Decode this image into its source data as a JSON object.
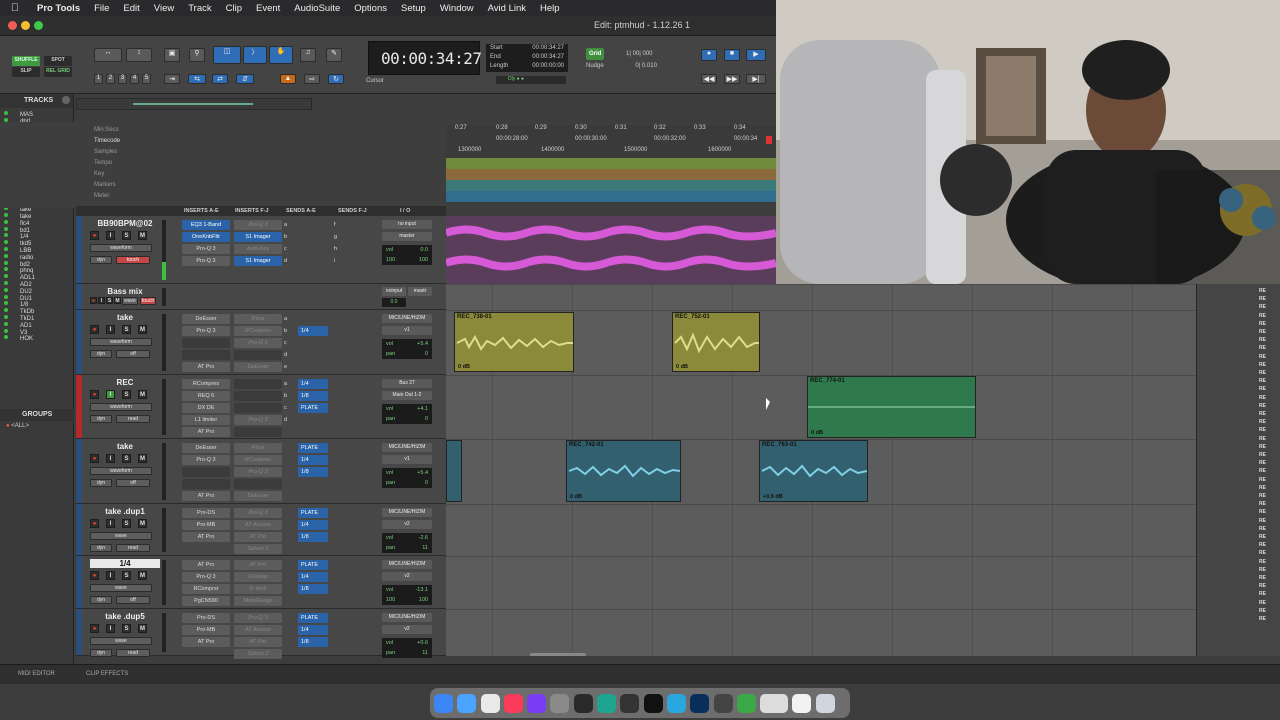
{
  "menubar": {
    "app_name": "Pro Tools",
    "items": [
      "File",
      "Edit",
      "View",
      "Track",
      "Clip",
      "Event",
      "AudioSuite",
      "Options",
      "Setup",
      "Window",
      "Avid Link",
      "Help"
    ]
  },
  "window": {
    "title": "Edit: ptmhud - 1.12.26 1"
  },
  "toolbar": {
    "modes": [
      "SHUFFLE",
      "SPOT",
      "SLIP",
      "REL GRID"
    ],
    "zoom_presets": [
      "1",
      "2",
      "3",
      "4",
      "5"
    ],
    "main_counter": "00:00:34:27",
    "cursor_label": "Cursor",
    "sub_counter": [
      {
        "label": "Start",
        "value": "00:00:34:27"
      },
      {
        "label": "End",
        "value": "00:00:34:27"
      },
      {
        "label": "Length",
        "value": "00:00:00:00"
      }
    ],
    "grid_label": "Grid",
    "grid_value": "1| 00| 000",
    "nudge_label": "Nudge",
    "nudge_value": "0| 0.010"
  },
  "rulers": {
    "rows": [
      "Min:Secs",
      "Timecode",
      "Samples",
      "Tempo",
      "Key",
      "Markers",
      "Meter"
    ],
    "minsecs_ticks": [
      "0:27",
      "0:28",
      "0:29",
      "0:30",
      "0:31",
      "0:32",
      "0:33",
      "0:34"
    ],
    "timecode_ticks": [
      "00:00:28:00",
      "00:00:30:00",
      "00:00:32:00",
      "00:00:34"
    ],
    "sample_ticks": [
      "1300000",
      "1400000",
      "1500000",
      "1600000"
    ]
  },
  "tracks_panel": {
    "title": "TRACKS",
    "items": [
      "MAS",
      "dbl1",
      "pc1",
      "pc2",
      "Verb",
      "Verb",
      "14DI",
      "18DI",
      "V2d1",
      "V2",
      "V1",
      "REC",
      "S002",
      "Bum",
      "take",
      "take",
      "flc4",
      "bd1",
      "1/4",
      "tkd5",
      "LBB",
      "radio",
      "bd2",
      "phnq",
      "ADL1",
      "AD2",
      "DU2",
      "DU1",
      "1/8",
      "TkDb",
      "TkD1",
      "AD1",
      "V3",
      "HOK"
    ],
    "groups_title": "GROUPS",
    "groups_all": "<ALL>"
  },
  "track_columns": [
    "INSERTS A-E",
    "INSERTS F-J",
    "SENDS A-E",
    "SENDS F-J",
    "I / O"
  ],
  "tracks": [
    {
      "name": "BB90BPM@02",
      "view": "waveform",
      "auto": "touch",
      "inserts_ae": [
        "EQ3 1-Band",
        "OneKnbFltr",
        "Pro-Q 3",
        "Pro-Q 3"
      ],
      "inserts_fj": [
        "Pro-Q 3",
        "S1 Imager",
        "Auto-Key",
        "S1 Imager"
      ],
      "sends": [
        "a",
        "b",
        "c",
        "d"
      ],
      "sends2": [
        "f",
        "g",
        "h",
        "i"
      ],
      "input": "no input",
      "output": "master",
      "vol": "0.0",
      "pan_l": "100",
      "pan_r": "100"
    },
    {
      "name": "Bass mix",
      "view": "wave",
      "auto": "touch",
      "input": "noinput",
      "output": "mastr",
      "vol": "0.0"
    },
    {
      "name": "take",
      "view": "waveform",
      "auto": "off",
      "inserts_ae": [
        "DeEsser",
        "Pro-Q 3",
        "",
        "",
        "AT Pro"
      ],
      "inserts_fj": [
        "RVox",
        "RCompres",
        "Pro-Q 3",
        "",
        "DeEsser"
      ],
      "sends": [
        "a",
        "b",
        "c",
        "d",
        "e"
      ],
      "send_on": "1/4",
      "input": "MIC/LINE/HIZ/M",
      "output": "v1",
      "vol": "+5.4",
      "pan": "0"
    },
    {
      "name": "REC",
      "view": "waveform",
      "auto": "read",
      "inserts_ae": [
        "RCompres",
        "REQ 6",
        "DX DE",
        "L1 limiter",
        "AT Pro"
      ],
      "inserts_fj": [
        "",
        "",
        "",
        "Pro-Q 3",
        ""
      ],
      "sends": [
        "a",
        "b",
        "c",
        "d"
      ],
      "send_on": [
        "1/4",
        "1/8",
        "PLATE"
      ],
      "input": "Bus 27",
      "output": "Main Out 1-2",
      "vol": "+4.1",
      "pan": "0"
    },
    {
      "name": "take",
      "view": "waveform",
      "auto": "off",
      "inserts_ae": [
        "DeEsser",
        "Pro-Q 3",
        "",
        "",
        "AT Pro"
      ],
      "inserts_fj": [
        "RVox",
        "RCompres",
        "Pro-Q 3",
        "",
        "DeEsser"
      ],
      "send_on": [
        "PLATE",
        "1/4",
        "1/8"
      ],
      "input": "MIC/LINE/HIZ/M",
      "output": "v1",
      "vol": "+5.4",
      "pan": "0"
    },
    {
      "name": "take .dup1",
      "view": "wave",
      "auto": "read",
      "inserts_ae": [
        "Pro-DS",
        "Pro-MB",
        "AT Pro"
      ],
      "inserts_fj": [
        "Pro-Q 3",
        "AT Access",
        "AT Pro",
        "Saturn 2"
      ],
      "send_on": [
        "PLATE",
        "1/4",
        "1/8"
      ],
      "input": "MIC/LINE/HIZ/M",
      "output": "v2",
      "vol": "-2.6",
      "pan": "11"
    },
    {
      "name": "1/4",
      "view": "wave",
      "auto": "off",
      "inserts_ae": [
        "AT Pro",
        "Pro-Q 3",
        "RComprsr",
        "PgCN590"
      ],
      "inserts_fj": [
        "AT Pro",
        "H-Delay",
        "D-Verb",
        "MetaFlange"
      ],
      "send_on": [
        "PLATE",
        "1/4",
        "1/8"
      ],
      "input": "MIC/LINE/HIZ/M",
      "output": "v2",
      "vol": "-13.1",
      "pan_l": "100",
      "pan_r": "100"
    },
    {
      "name": "take .dup5",
      "view": "wave",
      "auto": "read",
      "inserts_ae": [
        "Pro-DS",
        "Pro-MB",
        "AT Pro"
      ],
      "inserts_fj": [
        "Pro-Q 3",
        "AT Access",
        "AT Pro",
        "Saturn 2"
      ],
      "send_on": [
        "PLATE",
        "1/4",
        "1/8"
      ],
      "input": "MIC/LINE/HIZ/M",
      "output": "v2",
      "vol": "+0.6",
      "pan": "11"
    }
  ],
  "clips": [
    {
      "name": "REC_738-01",
      "gain": "0 dB"
    },
    {
      "name": "REC_752-01",
      "gain": "0 dB"
    },
    {
      "name": "REC_774-01",
      "gain": "0 dB"
    },
    {
      "name": "REC_742-01",
      "gain": "0 dB"
    },
    {
      "name": "REC_763-01",
      "gain": "+0.9 dB"
    }
  ],
  "right_labels": [
    "RE",
    "RE",
    "RE",
    "RE",
    "RE",
    "RE",
    "RE",
    "RE",
    "RE",
    "RE",
    "RE",
    "RE",
    "RE",
    "RE",
    "RE",
    "RE",
    "RE",
    "RE",
    "RE",
    "RE",
    "RE",
    "RE",
    "RE",
    "RE",
    "RE",
    "RE",
    "RE",
    "RE",
    "RE",
    "RE",
    "RE",
    "RE",
    "RE",
    "RE",
    "RE",
    "RE",
    "RE",
    "RE",
    "RE",
    "RE",
    "RE"
  ],
  "bottom": {
    "midi_editor": "MIDI EDITOR",
    "clip_effects": "CLIP EFFECTS"
  },
  "colors": {
    "accent_blue": "#2a63a8",
    "clip_yellow": "#8a8a3a",
    "clip_green": "#2f7a4c",
    "clip_blue": "#33606e",
    "record_red": "#e43"
  }
}
